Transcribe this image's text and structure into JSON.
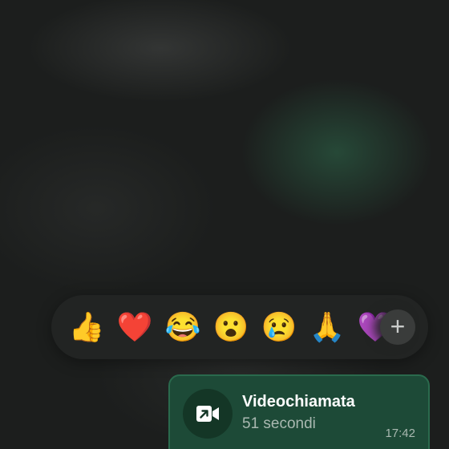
{
  "reactions": {
    "emojis": [
      {
        "name": "thumbs-up",
        "glyph": "👍"
      },
      {
        "name": "red-heart",
        "glyph": "❤️"
      },
      {
        "name": "tears-of-joy",
        "glyph": "😂"
      },
      {
        "name": "astonished",
        "glyph": "😮"
      },
      {
        "name": "crying",
        "glyph": "😢"
      },
      {
        "name": "folded-hands",
        "glyph": "🙏"
      },
      {
        "name": "purple-heart",
        "glyph": "💜"
      }
    ],
    "more_icon": "plus-icon",
    "more_glyph": "+"
  },
  "message": {
    "type": "video-call",
    "icon": "video-call-outgoing-icon",
    "title": "Videochiamata",
    "duration": "51 secondi",
    "time": "17:42"
  },
  "colors": {
    "bubble_bg": "#1d4a37",
    "bubble_border": "#2a6a4d",
    "reaction_bar_bg": "#222423"
  }
}
